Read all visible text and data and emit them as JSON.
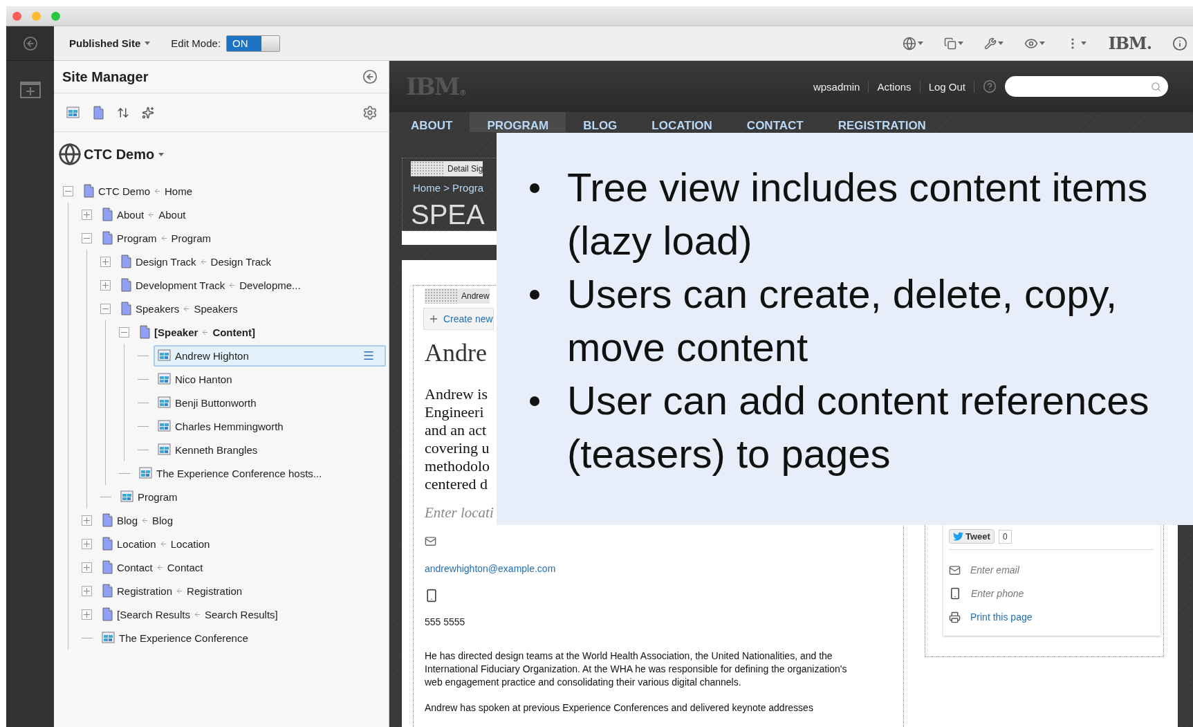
{
  "toolbar": {
    "site_menu": "Published Site",
    "edit_mode": {
      "label": "Edit Mode:",
      "toggle": "ON",
      "on": true
    },
    "logo": "IBM."
  },
  "site_manager": {
    "title": "Site Manager",
    "site": "CTC Demo",
    "tree": [
      {
        "label": "CTC Demo",
        "mapped": "Home",
        "kind": "page",
        "expanded": true,
        "selected": false,
        "children": [
          {
            "label": "About",
            "mapped": "About",
            "kind": "page",
            "expanded": false,
            "selected": false
          },
          {
            "label": "Program",
            "mapped": "Program",
            "kind": "page",
            "expanded": true,
            "selected": false,
            "children": [
              {
                "label": "Design Track",
                "mapped": "Design Track",
                "kind": "page",
                "expanded": false,
                "selected": false
              },
              {
                "label": "Development Track",
                "mapped": "Developme...",
                "kind": "page",
                "expanded": false,
                "selected": false
              },
              {
                "label": "Speakers",
                "mapped": "Speakers",
                "kind": "page",
                "expanded": true,
                "selected": false,
                "children": [
                  {
                    "label": "[Speaker",
                    "mapped": "Content]",
                    "kind": "page",
                    "expanded": true,
                    "selected": false,
                    "current": true,
                    "children": [
                      {
                        "label": "Andrew Highton",
                        "kind": "content",
                        "selected": true
                      },
                      {
                        "label": "Nico Hanton",
                        "kind": "content",
                        "selected": false
                      },
                      {
                        "label": "Benji Buttonworth",
                        "kind": "content",
                        "selected": false
                      },
                      {
                        "label": "Charles Hemmingworth",
                        "kind": "content",
                        "selected": false
                      },
                      {
                        "label": "Kenneth Brangles",
                        "kind": "content",
                        "selected": false
                      }
                    ]
                  },
                  {
                    "label": "The Experience Conference hosts...",
                    "kind": "content",
                    "selected": false
                  }
                ]
              },
              {
                "label": "Program",
                "kind": "content",
                "selected": false
              }
            ]
          },
          {
            "label": "Blog",
            "mapped": "Blog",
            "kind": "page",
            "expanded": false,
            "selected": false
          },
          {
            "label": "Location",
            "mapped": "Location",
            "kind": "page",
            "expanded": false,
            "selected": false
          },
          {
            "label": "Contact",
            "mapped": "Contact",
            "kind": "page",
            "expanded": false,
            "selected": false
          },
          {
            "label": "Registration",
            "mapped": "Registration",
            "kind": "page",
            "expanded": false,
            "selected": false
          },
          {
            "label": "[Search Results",
            "mapped": "Search Results]",
            "kind": "page",
            "expanded": false,
            "selected": false
          },
          {
            "label": "The Experience Conference",
            "kind": "content",
            "selected": false
          }
        ]
      }
    ]
  },
  "website": {
    "header": {
      "logo": "IBM",
      "logo_mark": "®",
      "links": [
        "wpsadmin",
        "Actions",
        "Log Out"
      ]
    },
    "nav": [
      {
        "label": "ABOUT",
        "selected": false
      },
      {
        "label": "PROGRAM",
        "selected": true
      },
      {
        "label": "BLOG",
        "selected": false
      },
      {
        "label": "LOCATION",
        "selected": false
      },
      {
        "label": "CONTACT",
        "selected": false
      },
      {
        "label": "REGISTRATION",
        "selected": false
      }
    ],
    "detail": {
      "tag": "Detail Sig",
      "breadcrumb": "Home > Progra",
      "title": "SPEA"
    },
    "card": {
      "tag": "Andrew",
      "create": "Create new",
      "heading": "Andre",
      "intro_lines": [
        "Andrew is",
        "Engineeri",
        "and an act",
        "covering u",
        "methodolo",
        "centered d"
      ],
      "location_hint": "Enter locati",
      "email": "andrewhighton@example.com",
      "phone": "555 5555",
      "bio": [
        "He has directed design teams at the World Health Association, the United Nationalities, and the International Fiduciary Organization. At the WHA he was responsible for defining the organization's web engagement practice and consolidating their various digital channels.",
        "Andrew has spoken at previous Experience Conferences and delivered keynote addresses"
      ]
    },
    "sidebar": {
      "tweet": "Tweet",
      "tweet_count": "0",
      "email_hint": "Enter email",
      "phone_hint": "Enter phone",
      "print": "Print this page"
    }
  },
  "callout": {
    "bullets": [
      {
        "lines": [
          "Tree view includes content items",
          "(lazy load)"
        ]
      },
      {
        "lines": [
          "Users can create, delete, copy,",
          "move content"
        ]
      },
      {
        "lines": [
          "User can add content references",
          "(teasers) to pages"
        ]
      }
    ]
  }
}
